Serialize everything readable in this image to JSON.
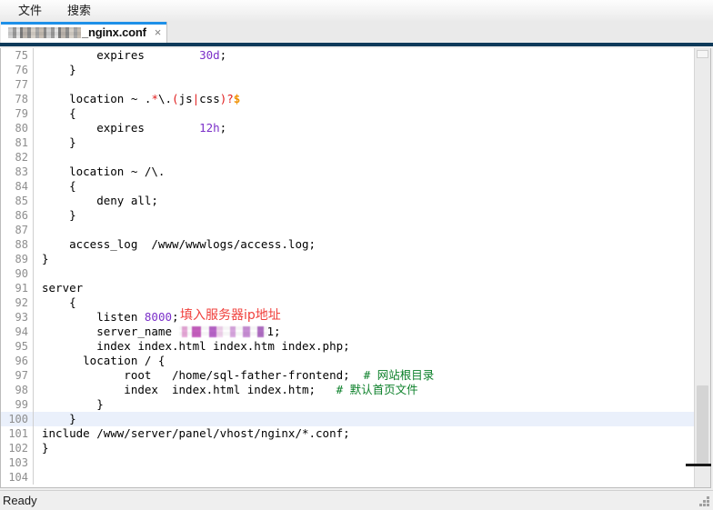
{
  "menubar": {
    "items": [
      {
        "label": "文件",
        "name": "menu-file"
      },
      {
        "label": "搜索",
        "name": "menu-search"
      }
    ]
  },
  "tab": {
    "redacted_prefix": "[redacted]",
    "label": "_nginx.conf",
    "close_glyph": "×"
  },
  "statusbar": {
    "text": "Ready"
  },
  "colors": {
    "accent_tab": "#1e90e8",
    "dark_rule": "#0e3a5a",
    "number": "#7b30c9",
    "regex": "#e01b1b",
    "dollar": "#f09000",
    "comment": "#0a7f28",
    "annotation": "#f0403c",
    "current_line": "#eaf0fb"
  },
  "editor": {
    "first_line": 75,
    "current_line": 100,
    "annotation": "填入服务器ip地址",
    "lines": [
      {
        "n": 75,
        "parts": [
          {
            "t": "        expires        "
          },
          {
            "t": "30d",
            "c": "tk-num"
          },
          {
            "t": ";"
          }
        ]
      },
      {
        "n": 76,
        "parts": [
          {
            "t": "    }"
          }
        ]
      },
      {
        "n": 77,
        "parts": [
          {
            "t": ""
          }
        ]
      },
      {
        "n": 78,
        "parts": [
          {
            "t": "    location "
          },
          {
            "t": "~"
          },
          {
            "t": " ."
          },
          {
            "t": "*",
            "c": "tk-rx"
          },
          {
            "t": "\\."
          },
          {
            "t": "(",
            "c": "tk-rx"
          },
          {
            "t": "js"
          },
          {
            "t": "|",
            "c": "tk-rx"
          },
          {
            "t": "css"
          },
          {
            "t": ")",
            "c": "tk-rx"
          },
          {
            "t": "?",
            "c": "tk-rx"
          },
          {
            "t": "$",
            "c": "tk-dollar"
          }
        ]
      },
      {
        "n": 79,
        "parts": [
          {
            "t": "    {"
          }
        ]
      },
      {
        "n": 80,
        "parts": [
          {
            "t": "        expires        "
          },
          {
            "t": "12h",
            "c": "tk-num"
          },
          {
            "t": ";"
          }
        ]
      },
      {
        "n": 81,
        "parts": [
          {
            "t": "    }"
          }
        ]
      },
      {
        "n": 82,
        "parts": [
          {
            "t": ""
          }
        ]
      },
      {
        "n": 83,
        "parts": [
          {
            "t": "    location ~ /\\."
          }
        ]
      },
      {
        "n": 84,
        "parts": [
          {
            "t": "    {"
          }
        ]
      },
      {
        "n": 85,
        "parts": [
          {
            "t": "        deny all;"
          }
        ]
      },
      {
        "n": 86,
        "parts": [
          {
            "t": "    }"
          }
        ]
      },
      {
        "n": 87,
        "parts": [
          {
            "t": ""
          }
        ]
      },
      {
        "n": 88,
        "parts": [
          {
            "t": "    access_log  /www/wwwlogs/access.log;"
          }
        ]
      },
      {
        "n": 89,
        "parts": [
          {
            "t": "}"
          }
        ]
      },
      {
        "n": 90,
        "parts": [
          {
            "t": ""
          }
        ]
      },
      {
        "n": 91,
        "parts": [
          {
            "t": "server"
          }
        ]
      },
      {
        "n": 92,
        "parts": [
          {
            "t": "    {"
          }
        ]
      },
      {
        "n": 93,
        "parts": [
          {
            "t": "        listen "
          },
          {
            "t": "8000",
            "c": "tk-num"
          },
          {
            "t": ";"
          }
        ]
      },
      {
        "n": 94,
        "parts": [
          {
            "t": "        server_name "
          },
          {
            "redact": true
          },
          {
            "t": "1;"
          }
        ]
      },
      {
        "n": 95,
        "parts": [
          {
            "t": "        index index.html index.htm index.php;"
          }
        ]
      },
      {
        "n": 96,
        "parts": [
          {
            "t": "      location / {"
          }
        ]
      },
      {
        "n": 97,
        "parts": [
          {
            "t": "            root   /home/sql-father-frontend;  "
          },
          {
            "t": "# 网站根目录",
            "c": "tk-cmt"
          }
        ]
      },
      {
        "n": 98,
        "parts": [
          {
            "t": "            index  index.html index.htm;   "
          },
          {
            "t": "# 默认首页文件",
            "c": "tk-cmt"
          }
        ]
      },
      {
        "n": 99,
        "parts": [
          {
            "t": "        }"
          }
        ]
      },
      {
        "n": 100,
        "parts": [
          {
            "t": "    }"
          }
        ]
      },
      {
        "n": 101,
        "parts": [
          {
            "t": "include /www/server/panel/vhost/nginx/*.conf;"
          }
        ]
      },
      {
        "n": 102,
        "parts": [
          {
            "t": "}"
          }
        ]
      },
      {
        "n": 103,
        "parts": [
          {
            "t": ""
          }
        ]
      },
      {
        "n": 104,
        "parts": [
          {
            "t": ""
          }
        ]
      }
    ]
  }
}
